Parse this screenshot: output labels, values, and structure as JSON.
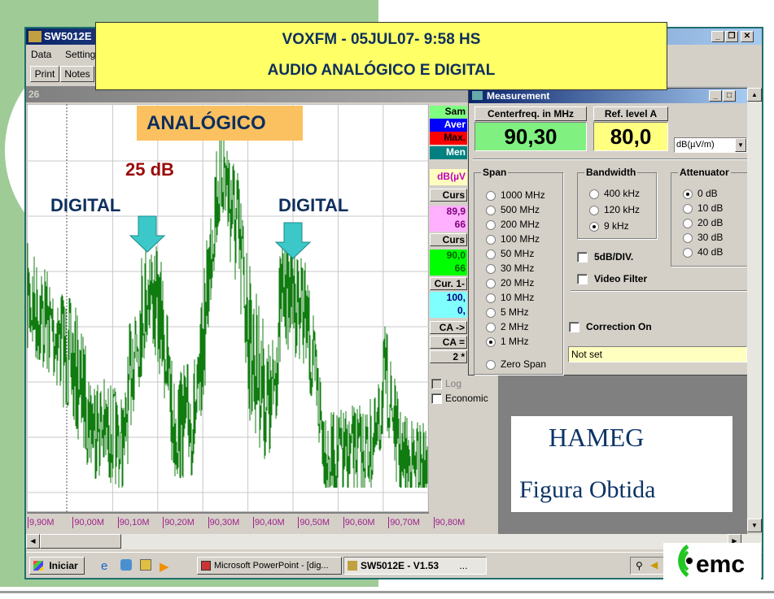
{
  "banner": {
    "line1": "VOXFM  - 05JUL07- 9:58  HS",
    "line2": "AUDIO ANALÓGICO E DIGITAL"
  },
  "window": {
    "title": "SW5012E",
    "menu": [
      "Data",
      "Settings"
    ],
    "toolbar": [
      "Print",
      "Notes"
    ],
    "caption_buttons": [
      "_",
      "❐",
      "✕"
    ]
  },
  "child": {
    "title": "26"
  },
  "annotations": {
    "analog": "ANALÓGICO",
    "db": "25 dB",
    "digital_left": "DIGITAL",
    "digital_right": "DIGITAL",
    "arrow_color": "#3cc8c8",
    "label_color": "#0d2f5e",
    "db_color": "#9b0a0a"
  },
  "plot": {
    "trace_color": "#107c10",
    "x_labels": [
      "9,90M",
      "90,00M",
      "90,10M",
      "90,20M",
      "90,30M",
      "90,40M",
      "90,50M",
      "90,60M",
      "90,70M",
      "90,80M"
    ]
  },
  "side_panel": {
    "items": [
      {
        "text": "Sam",
        "bg": "#80ff80",
        "fg": "#000"
      },
      {
        "text": "Aver",
        "bg": "#0000ff",
        "fg": "#fff"
      },
      {
        "text": "Max.",
        "bg": "#ff0000",
        "fg": "#000"
      },
      {
        "text": "Men",
        "bg": "#008080",
        "fg": "#fff"
      },
      {
        "text": "dB(µV",
        "bg": "#ffffc0",
        "fg": "#c000c0"
      },
      {
        "text": "Curs",
        "bg": "#d4d0c8",
        "fg": "#000"
      },
      {
        "text": "89,9",
        "bg": "#ffb0ff",
        "fg": "#800080"
      },
      {
        "text": "66",
        "bg": "#ffb0ff",
        "fg": "#800080"
      },
      {
        "text": "Curs",
        "bg": "#d4d0c8",
        "fg": "#000"
      },
      {
        "text": "90,0",
        "bg": "#00ff00",
        "fg": "#006000"
      },
      {
        "text": "66",
        "bg": "#00ff00",
        "fg": "#006000"
      },
      {
        "text": "Cur. 1-",
        "bg": "#d4d0c8",
        "fg": "#000"
      },
      {
        "text": "100,",
        "bg": "#80ffff",
        "fg": "#000080"
      },
      {
        "text": "0,",
        "bg": "#80ffff",
        "fg": "#000080"
      },
      {
        "text": "CA ->",
        "bg": "#d4d0c8",
        "fg": "#000"
      },
      {
        "text": "CA =",
        "bg": "#d4d0c8",
        "fg": "#000"
      },
      {
        "text": "2 *",
        "bg": "#d4d0c8",
        "fg": "#000"
      }
    ],
    "log": "Log",
    "economic": "Economic"
  },
  "measurement": {
    "title": "Measurement",
    "centerfreq_label": "Centerfreq. in MHz",
    "centerfreq_value": "90,30",
    "reflevel_label": "Ref. level A",
    "reflevel_value": "80,0",
    "unit": "dB(µV/m)",
    "span_title": "Span",
    "span_options": [
      "1000 MHz",
      "500 MHz",
      "200 MHz",
      "100 MHz",
      "50 MHz",
      "30 MHz",
      "20 MHz",
      "10 MHz",
      "5 MHz",
      "2 MHz",
      "1 MHz",
      "Zero Span"
    ],
    "span_selected": "1 MHz",
    "bandwidth_title": "Bandwidth",
    "bandwidth_options": [
      "400 kHz",
      "120 kHz",
      "9 kHz"
    ],
    "bandwidth_selected": "9 kHz",
    "attenuator_title": "Attenuator",
    "attenuator_options": [
      "0  dB",
      "10 dB",
      "20 dB",
      "30 dB",
      "40 dB"
    ],
    "attenuator_selected": "0  dB",
    "five_db_div": "5dB/DIV.",
    "video_filter": "Video Filter",
    "correction_on": "Correction On",
    "correction_value": "Not set"
  },
  "hameg_box": {
    "line1": "HAMEG",
    "line2": "Figura Obtida"
  },
  "taskbar": {
    "start": "Iniciar",
    "tasks": [
      "Microsoft PowerPoint - [dig...",
      "SW5012E - V1.53"
    ],
    "more": "..."
  },
  "logo": {
    "text": "emc"
  }
}
